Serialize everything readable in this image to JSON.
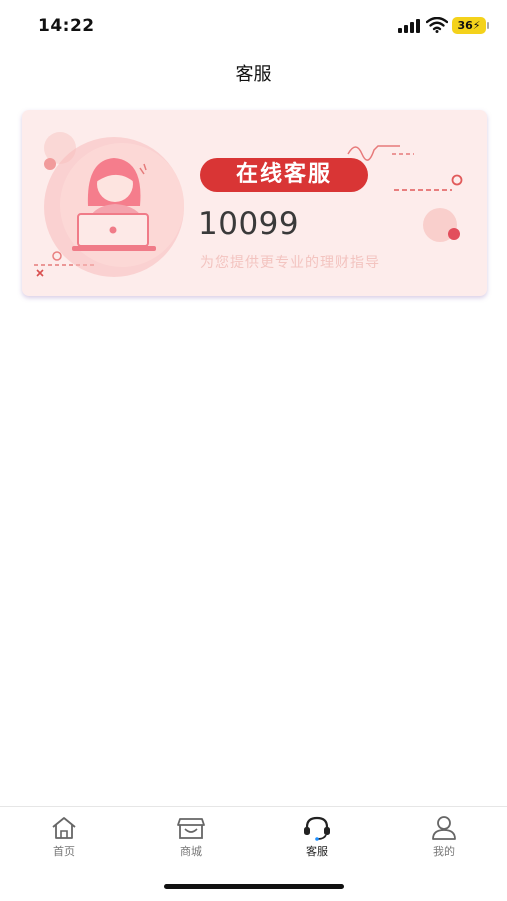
{
  "status_bar": {
    "time": "14:22",
    "battery": "36"
  },
  "header": {
    "title": "客服"
  },
  "service_card": {
    "badge": "在线客服",
    "phone": "10099",
    "subtitle": "为您提供更专业的理财指导"
  },
  "tab_bar": {
    "items": [
      {
        "label": "首页",
        "icon": "home-icon",
        "active": false
      },
      {
        "label": "商城",
        "icon": "shop-icon",
        "active": false
      },
      {
        "label": "客服",
        "icon": "headset-icon",
        "active": true
      },
      {
        "label": "我的",
        "icon": "user-icon",
        "active": false
      }
    ]
  },
  "colors": {
    "badge": "#d93535",
    "card_bg": "#fdeceb",
    "accent_pink": "#f08a8a"
  }
}
